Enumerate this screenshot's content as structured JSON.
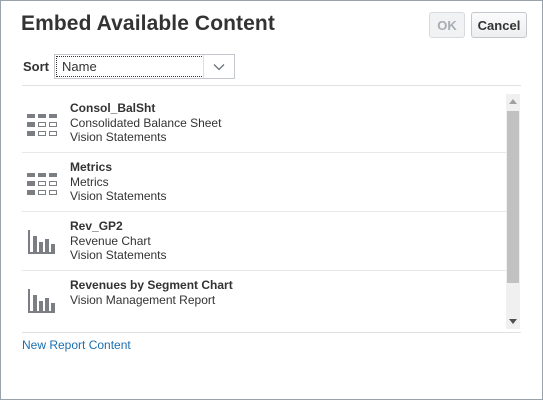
{
  "dialog": {
    "title": "Embed Available Content",
    "ok_label": "OK",
    "cancel_label": "Cancel"
  },
  "sort": {
    "label": "Sort",
    "selected": "Name"
  },
  "items": [
    {
      "name": "Consol_BalSht",
      "description": "Consolidated Balance Sheet",
      "source": "Vision Statements",
      "icon": "grid-icon"
    },
    {
      "name": "Metrics",
      "description": "Metrics",
      "source": "Vision Statements",
      "icon": "grid-icon"
    },
    {
      "name": "Rev_GP2",
      "description": "Revenue Chart",
      "source": "Vision Statements",
      "icon": "bar-chart-icon"
    },
    {
      "name": "Revenues by Segment Chart",
      "description": "Vision Management Report",
      "source": "",
      "icon": "bar-chart-icon"
    }
  ],
  "footer": {
    "new_report_link": "New Report Content"
  },
  "colors": {
    "link": "#1b6fb0",
    "icon": "#7b7f84"
  }
}
